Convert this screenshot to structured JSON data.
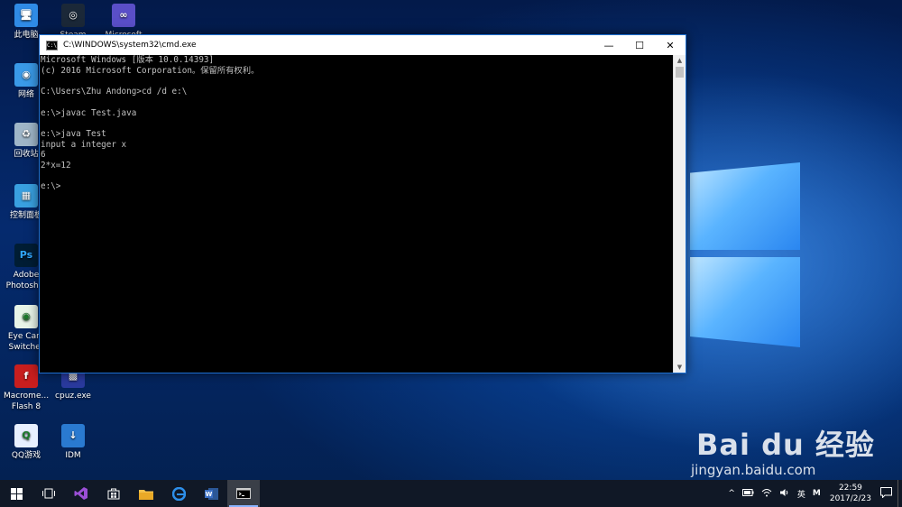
{
  "desktop_icons": [
    {
      "label": "此电脑",
      "x": "col1",
      "icon": "computer-icon"
    },
    {
      "label": "Steam",
      "icon": "steam-icon"
    },
    {
      "label": "Microsoft",
      "icon": "ms-icon"
    },
    {
      "label": "网络",
      "icon": "network-icon"
    },
    {
      "label": "回收站",
      "icon": "recycle-bin-icon"
    },
    {
      "label": "控制面板",
      "icon": "control-panel-icon"
    },
    {
      "label": "Adobe\nPhotosh...",
      "icon": "photoshop-icon"
    },
    {
      "label": "Eye Care\nSwitcher",
      "icon": "eye-care-icon"
    },
    {
      "label": "Macrome...\nFlash 8",
      "icon": "flash-icon"
    },
    {
      "label": "cpuz.exe",
      "icon": "cpuz-icon"
    },
    {
      "label": "QQ游戏",
      "icon": "qq-game-icon"
    },
    {
      "label": "IDM",
      "icon": "idm-icon"
    }
  ],
  "cmd": {
    "title": "C:\\WINDOWS\\system32\\cmd.exe",
    "appicon_text": "C:\\",
    "minimize": "—",
    "maximize": "☐",
    "close": "✕",
    "lines": [
      "Microsoft Windows [版本 10.0.14393]",
      "(c) 2016 Microsoft Corporation。保留所有权利。",
      "",
      "C:\\Users\\Zhu Andong>cd /d e:\\",
      "",
      "e:\\>javac Test.java",
      "",
      "e:\\>java Test",
      "input a integer x",
      "6",
      "2*x=12",
      "",
      "e:\\>"
    ]
  },
  "watermark": {
    "brand": "Bai du 经验",
    "url": "jingyan.baidu.com"
  },
  "taskbar": {
    "items": [
      "start",
      "task-view",
      "visual-studio",
      "store",
      "file-explorer",
      "edge",
      "word",
      "cmd"
    ],
    "tray": {
      "chevron": "^",
      "ime": "英",
      "ime_mode": "M",
      "time": "22:59",
      "date": "2017/2/23"
    }
  }
}
